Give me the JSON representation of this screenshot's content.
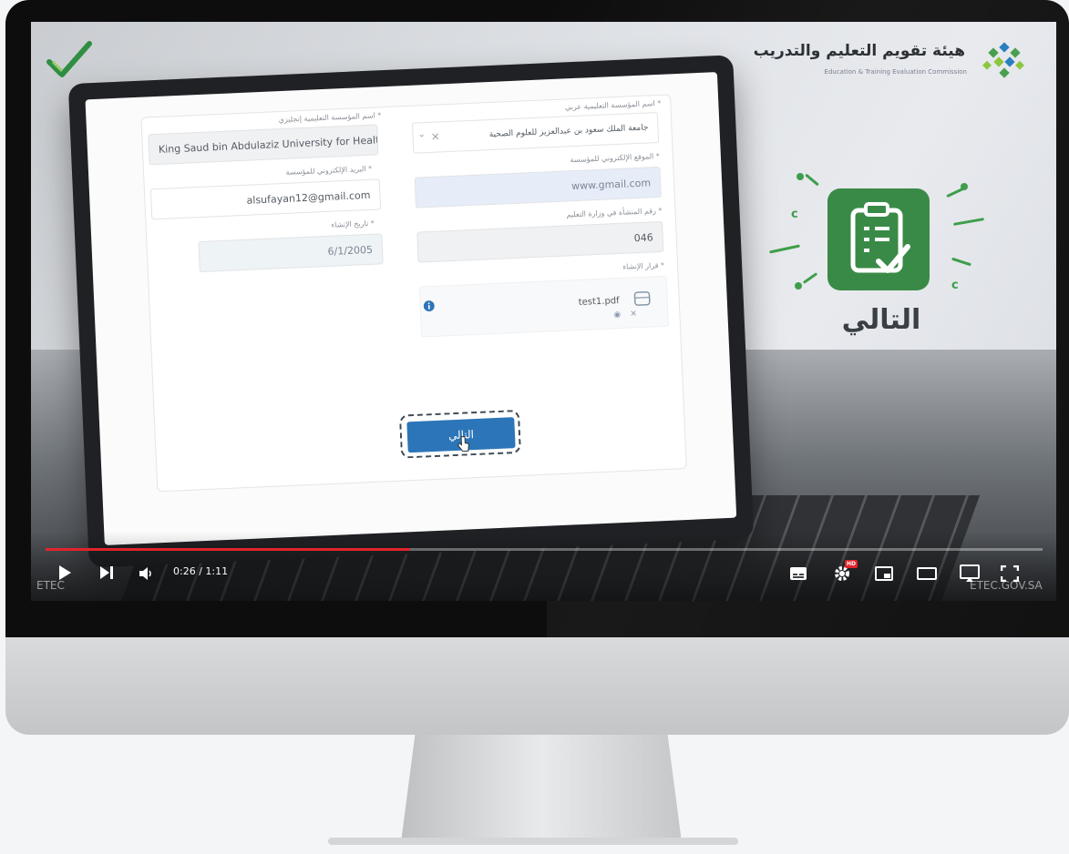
{
  "org": {
    "name_ar": "هيئة تقويم التعليم والتدريب",
    "name_en": "Education & Training Evaluation Commission"
  },
  "form": {
    "fields": [
      {
        "label": "اسم المؤسسة التعليمية إنجليزي *",
        "value": "King Saud bin Abdulaziz University for Health Sc"
      },
      {
        "label": "اسم المؤسسة التعليمية عربي *",
        "value": "جامعة الملك سعود بن عبدالعزيز للعلوم الصحية"
      },
      {
        "label": "البريد الإلكتروني للمؤسسة *",
        "value": "alsufayan12@gmail.com"
      },
      {
        "label": "الموقع الإلكتروني للمؤسسة *",
        "value": "www.gmail.com"
      },
      {
        "label": "تاريخ الإنشاء *",
        "value": "6/1/2005"
      },
      {
        "label": "رقم المنشأة في وزارة التعليم *",
        "value": "046"
      },
      {
        "label": "قرار الإنشاء *",
        "value": ""
      }
    ],
    "select_clear": "×",
    "file_name": "test1.pdf",
    "next_button": "التالي"
  },
  "overlay": {
    "next_label": "التالي"
  },
  "player": {
    "time": "0:26 / 1:11",
    "progress": 0.366,
    "hd_badge": "HD",
    "watermark_left": "ETEC",
    "watermark_right": "ETEC.GOV.SA"
  }
}
